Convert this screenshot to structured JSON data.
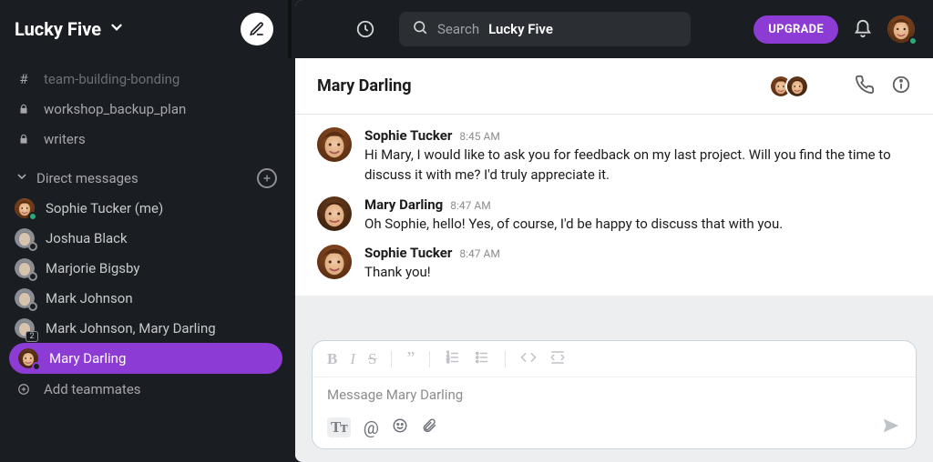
{
  "workspace": {
    "name": "Lucky Five"
  },
  "sidebar": {
    "channels": [
      {
        "name": "team-building-bonding",
        "icon": "hash",
        "dim": true
      },
      {
        "name": "workshop_backup_plan",
        "icon": "lock",
        "dim": false
      },
      {
        "name": "writers",
        "icon": "lock",
        "dim": false
      }
    ],
    "dm_section": "Direct messages",
    "dms": [
      {
        "name": "Sophie Tucker (me)",
        "presence": "on"
      },
      {
        "name": "Joshua Black",
        "presence": "off"
      },
      {
        "name": "Marjorie Bigsby",
        "presence": "off"
      },
      {
        "name": "Mark Johnson",
        "presence": "off"
      },
      {
        "name": "Mark Johnson, Mary Darling",
        "multi": true,
        "count": "2"
      },
      {
        "name": "Mary Darling",
        "presence": "off",
        "active": true
      }
    ],
    "add_teammates": "Add teammates"
  },
  "topbar": {
    "search_prefix": "Search",
    "search_bold": "Lucky Five",
    "upgrade": "UPGRADE"
  },
  "conversation": {
    "title": "Mary Darling",
    "messages": [
      {
        "who": "Sophie Tucker",
        "when": "8:45 AM",
        "text": "Hi Mary, I would like to ask you for feedback on my last project. Will you find the time to discuss it with me? I'd truly appreciate it.",
        "avatar": "sophie"
      },
      {
        "who": "Mary Darling",
        "when": "8:47 AM",
        "text": "Oh Sophie, hello! Yes, of course, I'd be happy to discuss that with you.",
        "avatar": "mary"
      },
      {
        "who": "Sophie Tucker",
        "when": "8:47 AM",
        "text": "Thank you!",
        "avatar": "sophie"
      }
    ],
    "placeholder": "Message Mary Darling"
  },
  "colors": {
    "accent": "#8c3cd4"
  }
}
